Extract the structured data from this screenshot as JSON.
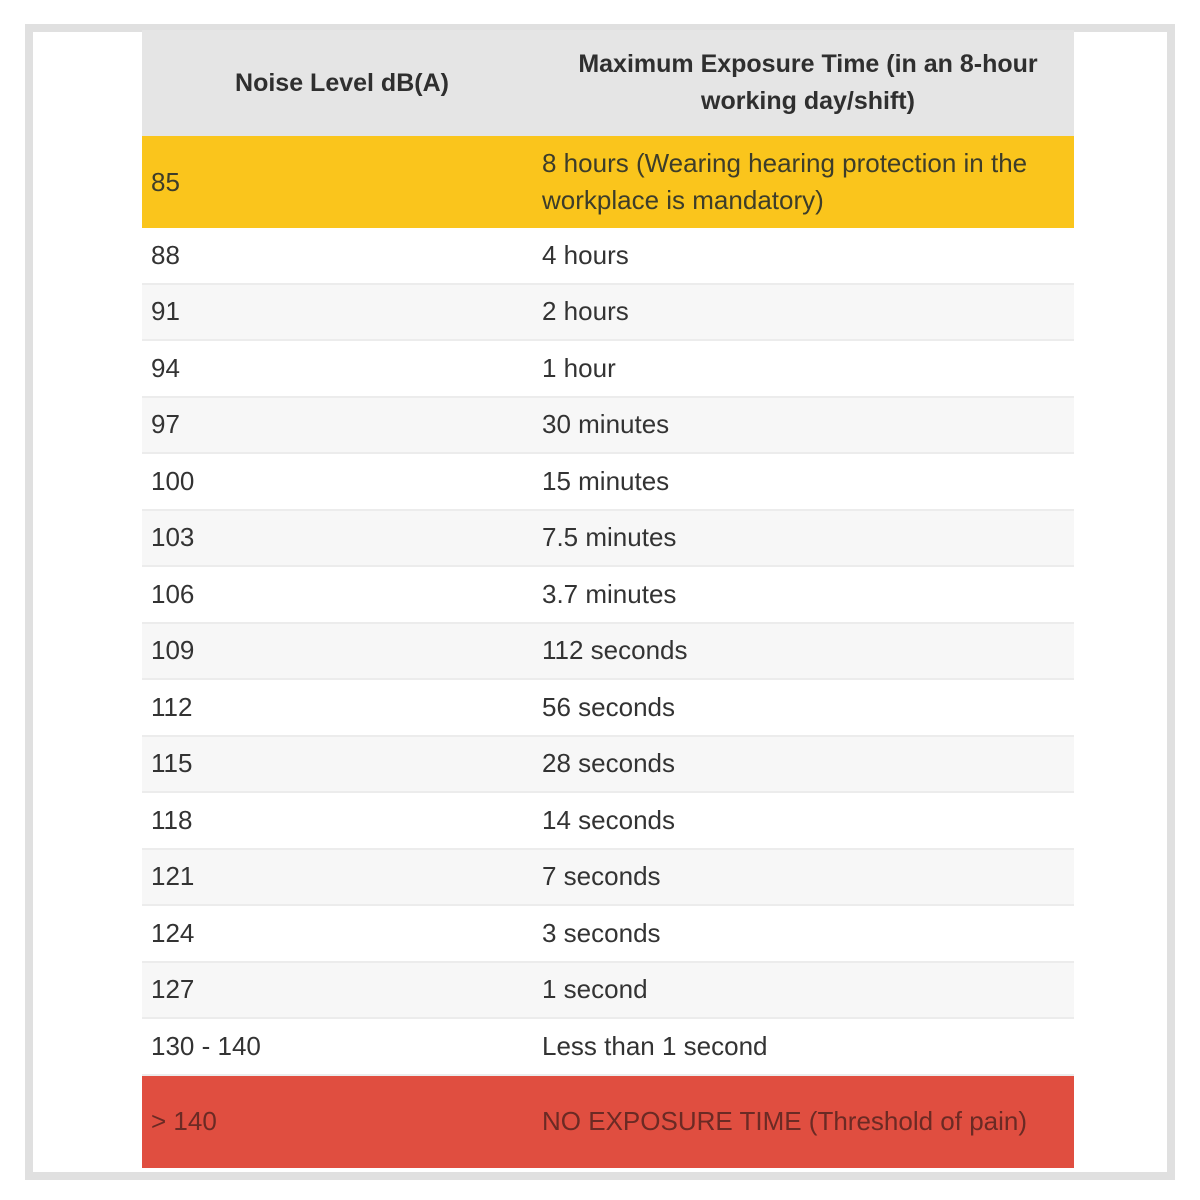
{
  "table": {
    "headers": [
      "Noise Level dB(A)",
      "Maximum Exposure Time (in an 8-hour working day/shift)"
    ],
    "rows": [
      {
        "level": "85",
        "time": "8 hours (Wearing hearing protection in the workplace is mandatory)",
        "highlight": "warning"
      },
      {
        "level": "88",
        "time": "4 hours"
      },
      {
        "level": "91",
        "time": "2 hours"
      },
      {
        "level": "94",
        "time": "1 hour"
      },
      {
        "level": "97",
        "time": "30 minutes"
      },
      {
        "level": "100",
        "time": "15 minutes"
      },
      {
        "level": "103",
        "time": "7.5 minutes"
      },
      {
        "level": "106",
        "time": "3.7 minutes"
      },
      {
        "level": "109",
        "time": "112 seconds"
      },
      {
        "level": "112",
        "time": "56 seconds"
      },
      {
        "level": "115",
        "time": "28 seconds"
      },
      {
        "level": "118",
        "time": "14 seconds"
      },
      {
        "level": "121",
        "time": "7 seconds"
      },
      {
        "level": "124",
        "time": "3 seconds"
      },
      {
        "level": "127",
        "time": "1 second"
      },
      {
        "level": "130 - 140",
        "time": "Less than 1 second"
      },
      {
        "level": "> 140",
        "time": "NO EXPOSURE TIME (Threshold of pain)",
        "highlight": "danger"
      }
    ]
  },
  "colors": {
    "header_bg": "#e5e5e5",
    "warning": "#fac51c",
    "danger": "#e04e40",
    "stripe": "#f7f7f7"
  }
}
